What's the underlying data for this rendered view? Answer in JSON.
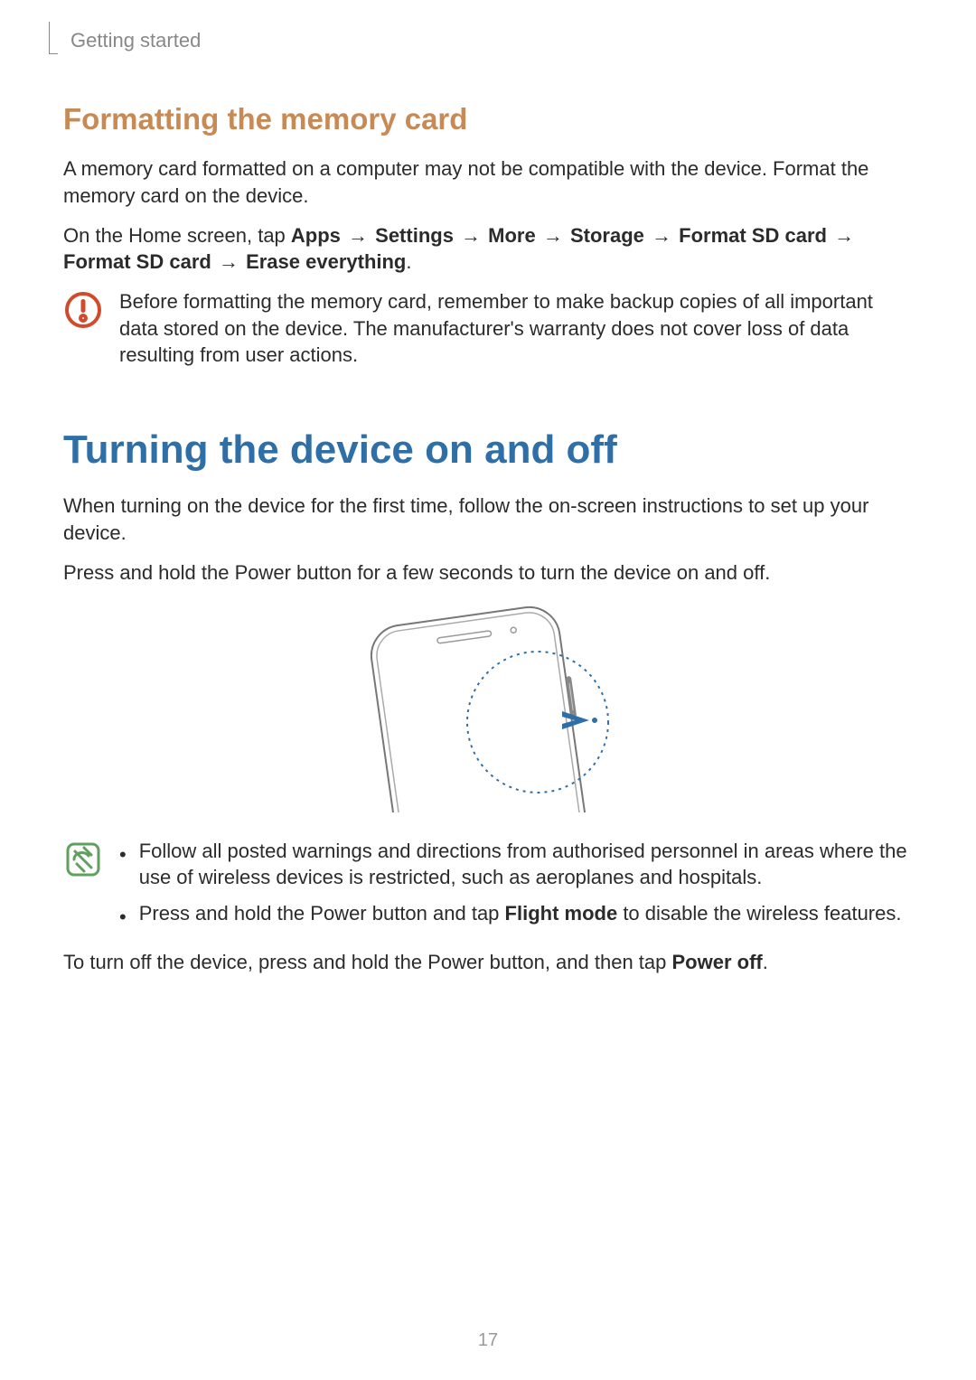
{
  "header": {
    "section": "Getting started"
  },
  "section_formatting": {
    "heading": "Formatting the memory card",
    "p1": "A memory card formatted on a computer may not be compatible with the device. Format the memory card on the device.",
    "path_intro": "On the Home screen, tap ",
    "path_steps": [
      "Apps",
      "Settings",
      "More",
      "Storage",
      "Format SD card",
      "Format SD card",
      "Erase everything"
    ],
    "arrow": " → ",
    "warning": "Before formatting the memory card, remember to make backup copies of all important data stored on the device. The manufacturer's warranty does not cover loss of data resulting from user actions."
  },
  "section_power": {
    "heading": "Turning the device on and off",
    "p1": "When turning on the device for the first time, follow the on-screen instructions to set up your device.",
    "p2": "Press and hold the Power button for a few seconds to turn the device on and off.",
    "note_bullets": [
      {
        "text": "Follow all posted warnings and directions from authorised personnel in areas where the use of wireless devices is restricted, such as aeroplanes and hospitals."
      },
      {
        "pre": "Press and hold the Power button and tap ",
        "bold": "Flight mode",
        "post": " to disable the wireless features."
      }
    ],
    "p3_pre": "To turn off the device, press and hold the Power button, and then tap ",
    "p3_bold": "Power off",
    "p3_post": "."
  },
  "page_number": "17"
}
